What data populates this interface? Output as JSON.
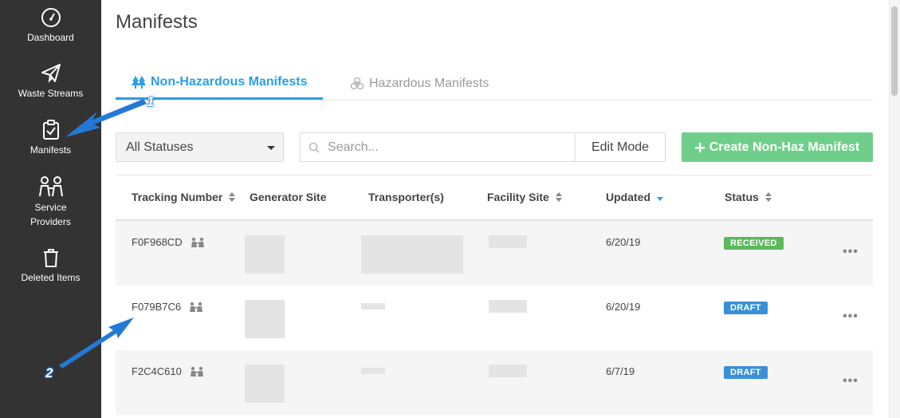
{
  "sidebar": {
    "items": [
      {
        "label": "Dashboard",
        "icon": "dashboard-icon"
      },
      {
        "label": "Waste Streams",
        "icon": "paper-plane-icon"
      },
      {
        "label": "Manifests",
        "icon": "clipboard-check-icon"
      },
      {
        "label": "Service Providers",
        "icon": "people-icon"
      },
      {
        "label": "Deleted Items",
        "icon": "trash-icon"
      }
    ],
    "service_providers_line1": "Service",
    "service_providers_line2": "Providers"
  },
  "page": {
    "title": "Manifests"
  },
  "tabs": [
    {
      "label": "Non-Hazardous Manifests",
      "icon": "trees-icon",
      "active": true
    },
    {
      "label": "Hazardous Manifests",
      "icon": "biohazard-icon",
      "active": false
    }
  ],
  "toolbar": {
    "status_filter": "All Statuses",
    "search_placeholder": "Search...",
    "edit_mode_label": "Edit Mode",
    "create_label": "Create Non-Haz Manifest"
  },
  "table": {
    "columns": [
      "Tracking Number",
      "Generator Site",
      "Transporter(s)",
      "Facility Site",
      "Updated",
      "Status"
    ],
    "rows": [
      {
        "tracking": "F0F968CD",
        "updated": "6/20/19",
        "status": "RECEIVED"
      },
      {
        "tracking": "F079B7C6",
        "updated": "6/20/19",
        "status": "DRAFT"
      },
      {
        "tracking": "F2C4C610",
        "updated": "6/7/19",
        "status": "DRAFT"
      }
    ],
    "more_label": "•••"
  },
  "annotations": {
    "one": "1",
    "two": "2"
  },
  "colors": {
    "sidebar": "#333333",
    "accent": "#2c9fe5",
    "create": "#6fcf8a",
    "received": "#5cb85c",
    "draft": "#3a8fd9",
    "arrow": "#2479d6"
  }
}
